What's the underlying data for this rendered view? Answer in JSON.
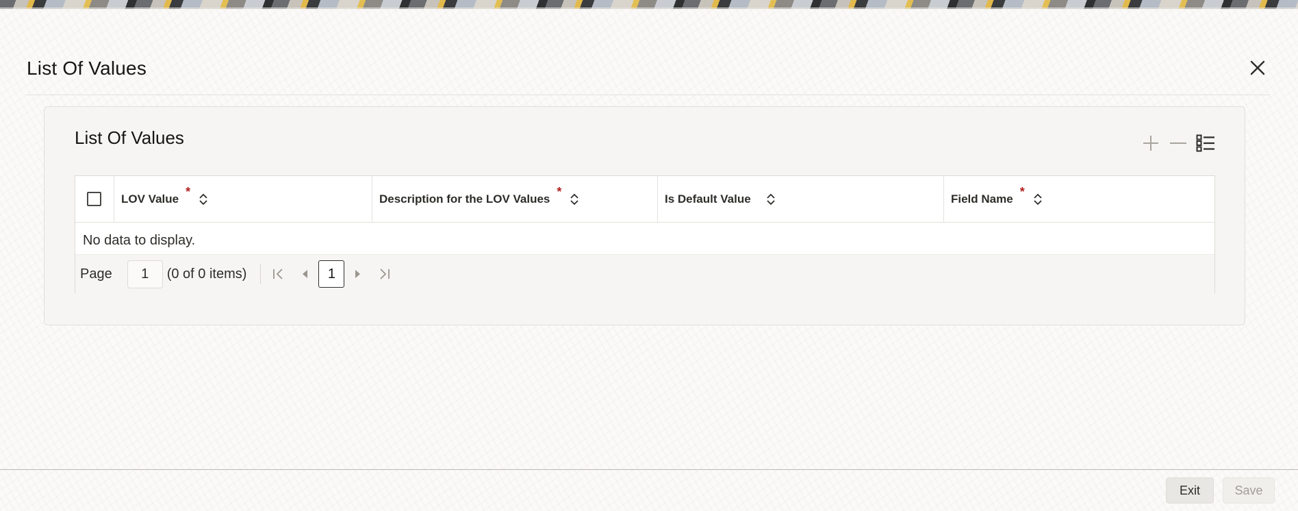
{
  "dialog": {
    "title": "List Of Values",
    "close_icon": "close-icon"
  },
  "panel": {
    "title": "List Of Values",
    "toolbar": {
      "add_icon": "plus-icon",
      "remove_icon": "minus-icon",
      "columns_icon": "list-view-icon"
    }
  },
  "grid": {
    "columns": [
      {
        "label": "LOV Value",
        "required": "*"
      },
      {
        "label": "Description for the LOV Values",
        "required": "*"
      },
      {
        "label": "Is Default Value",
        "required": ""
      },
      {
        "label": "Field Name",
        "required": "*"
      }
    ],
    "empty_text": "No data to display.",
    "pager": {
      "label": "Page",
      "current_page": "1",
      "count_text": "(0 of 0 items)",
      "page_button": "1"
    }
  },
  "footer": {
    "exit_label": "Exit",
    "save_label": "Save"
  },
  "colors": {
    "required": "#b22222",
    "text": "#161513"
  }
}
